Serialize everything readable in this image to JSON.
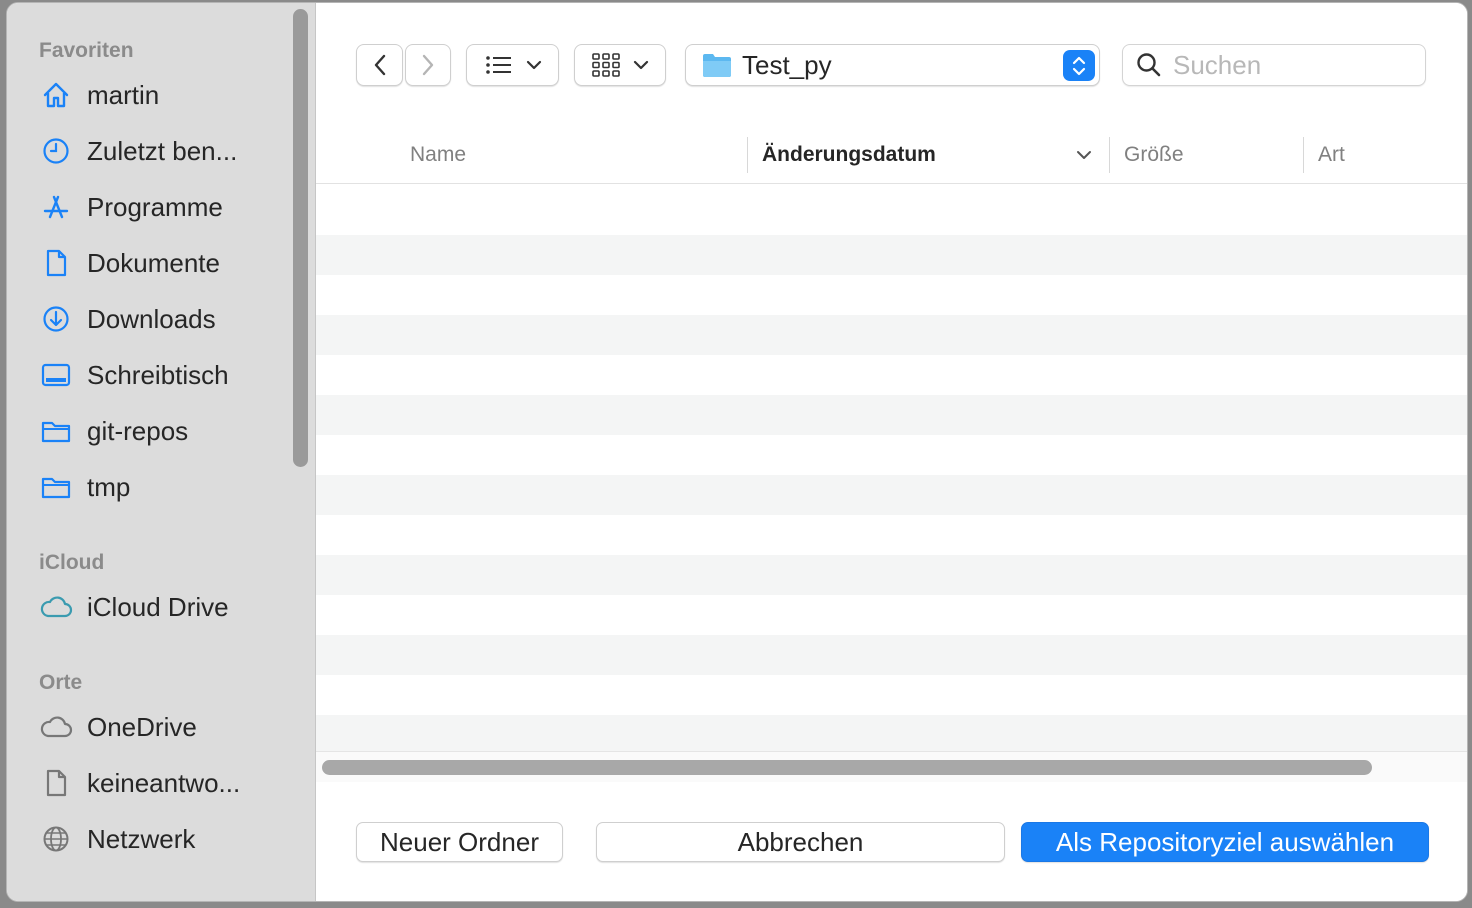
{
  "sidebar": {
    "sections": [
      {
        "title": "Favoriten"
      },
      {
        "title": "iCloud"
      },
      {
        "title": "Orte"
      }
    ],
    "items": [
      {
        "label": "martin",
        "icon": "home-icon"
      },
      {
        "label": "Zuletzt ben...",
        "icon": "clock-icon"
      },
      {
        "label": "Programme",
        "icon": "applications-icon"
      },
      {
        "label": "Dokumente",
        "icon": "document-icon"
      },
      {
        "label": "Downloads",
        "icon": "download-icon"
      },
      {
        "label": "Schreibtisch",
        "icon": "desktop-icon"
      },
      {
        "label": "git-repos",
        "icon": "folder-icon"
      },
      {
        "label": "tmp",
        "icon": "folder-icon"
      },
      {
        "label": "iCloud Drive",
        "icon": "icloud-icon"
      },
      {
        "label": "OneDrive",
        "icon": "cloud-icon"
      },
      {
        "label": "keineantwo...",
        "icon": "document-icon"
      },
      {
        "label": "Netzwerk",
        "icon": "globe-icon"
      }
    ]
  },
  "toolbar": {
    "current_folder": "Test_py",
    "search_placeholder": "Suchen"
  },
  "columns": {
    "name": "Name",
    "date": "Änderungsdatum",
    "size": "Größe",
    "kind": "Art"
  },
  "buttons": {
    "new_folder": "Neuer Ordner",
    "cancel": "Abbrechen",
    "confirm": "Als Repositoryziel auswählen"
  },
  "colors": {
    "accent": "#1a82f7",
    "sidebar_icon": "#1a82f7",
    "icloud_icon": "#3a9bb0",
    "sidebar_bg": "#dcdcdc"
  }
}
